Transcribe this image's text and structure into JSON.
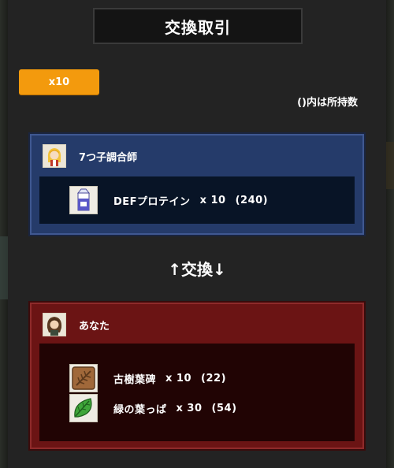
{
  "title": "交換取引",
  "multiplier_button": "x10",
  "owned_note": "()内は所持数",
  "exchange_label": "↑交換↓",
  "partner": {
    "name": "7つ子調合師",
    "items": [
      {
        "name": "DEFプロテイン",
        "qty": "x 10",
        "owned": "(240)",
        "icon": "milk-carton-icon"
      }
    ]
  },
  "you": {
    "name": "あなた",
    "items": [
      {
        "name": "古樹葉碑",
        "qty": "x 10",
        "owned": "(22)",
        "icon": "wood-tablet-icon"
      },
      {
        "name": "緑の葉っぱ",
        "qty": "x 30",
        "owned": "(54)",
        "icon": "green-leaf-icon"
      }
    ]
  },
  "colors": {
    "accent": "#f39a0d",
    "partner_panel": "#253b6a",
    "you_panel": "#6b1414"
  }
}
